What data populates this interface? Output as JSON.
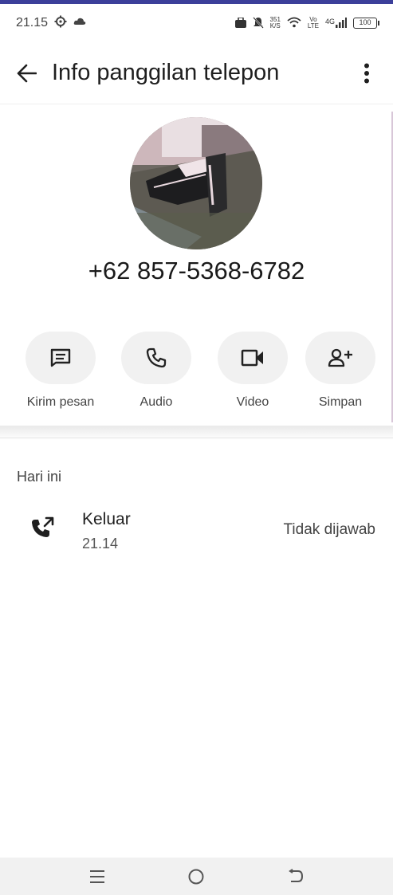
{
  "status_bar": {
    "time": "21.15",
    "net_speed_value": "351",
    "net_speed_unit": "K/S",
    "volte_top": "Vo",
    "volte_bottom": "LTE",
    "network": "4G",
    "battery": "100"
  },
  "app_bar": {
    "title": "Info panggilan telepon"
  },
  "contact": {
    "phone_number": "+62 857-5368-6782"
  },
  "actions": [
    {
      "label": "Kirim pesan",
      "icon": "message-icon"
    },
    {
      "label": "Audio",
      "icon": "phone-icon"
    },
    {
      "label": "Video",
      "icon": "video-icon"
    },
    {
      "label": "Simpan",
      "icon": "add-contact-icon"
    }
  ],
  "history": {
    "section_title": "Hari ini",
    "calls": [
      {
        "type": "Keluar",
        "time": "21.14",
        "status": "Tidak dijawab",
        "icon": "outgoing-call-icon"
      }
    ]
  },
  "colors": {
    "accent_bar": "#3c3f9a",
    "action_bg": "#f1f1f1",
    "nav_bg": "#f1f1f1"
  }
}
